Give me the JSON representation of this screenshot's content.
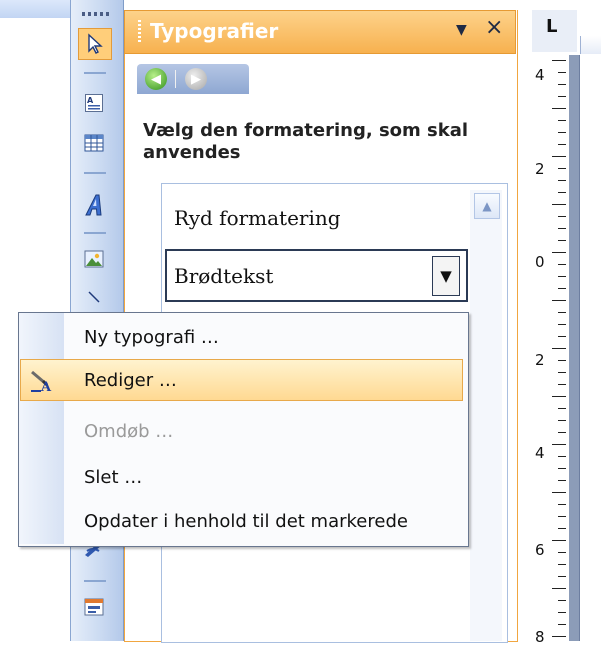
{
  "task_pane": {
    "title": "Typografier",
    "heading": "Vælg den formatering, som skal anvendes"
  },
  "style_list": {
    "items": [
      {
        "label": "Ryd formatering"
      },
      {
        "label": "Brødtekst"
      }
    ]
  },
  "ruler": {
    "corner_label": "L",
    "numbers": [
      "4",
      "2",
      "0",
      "2",
      "4",
      "6",
      "8"
    ]
  },
  "context_menu": {
    "items": [
      {
        "label": "Ny typografi …",
        "enabled": true,
        "highlighted": false
      },
      {
        "label": "Rediger …",
        "enabled": true,
        "highlighted": true
      },
      {
        "label": "Omdøb …",
        "enabled": false,
        "highlighted": false
      },
      {
        "label": "Slet …",
        "enabled": true,
        "highlighted": false
      },
      {
        "label": "Opdater i henhold til det markerede",
        "enabled": true,
        "highlighted": false
      }
    ]
  },
  "icons": {
    "toolbar": [
      "select-arrow-icon",
      "text-box-icon",
      "table-icon",
      "wordart-icon",
      "picture-icon",
      "callout-icon",
      "form-field-icon"
    ],
    "pane_dropdown": "dropdown-triangle-icon",
    "pane_close": "close-icon",
    "nav_back": "back-arrow-icon",
    "nav_forward": "forward-arrow-icon",
    "edit_style": "edit-style-icon"
  },
  "colors": {
    "pane_title": "#f7b14f",
    "menu_highlight": "#ffd992",
    "toolbar": "#c9d9f1"
  }
}
